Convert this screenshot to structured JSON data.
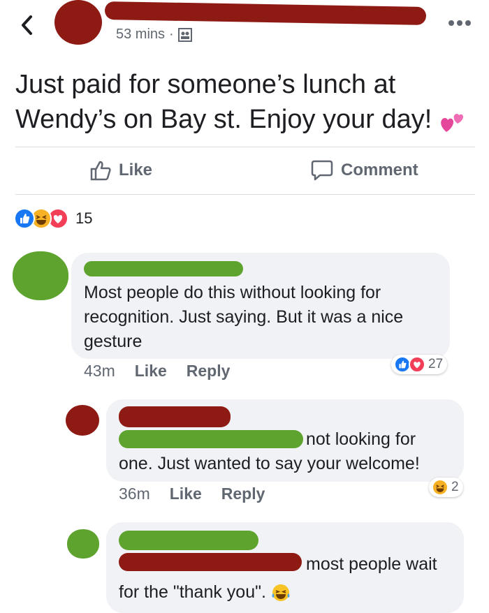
{
  "header": {
    "timestamp": "53 mins",
    "separator": "·"
  },
  "post": {
    "text_line1": "Just paid for someone’s lunch at",
    "text_line2": "Wendy’s on Bay st. Enjoy your day!"
  },
  "actions": {
    "like": "Like",
    "comment": "Comment"
  },
  "reactions": {
    "count": "15"
  },
  "comments": [
    {
      "text": "Most people do this without looking for recognition. Just saying. But it was a nice gesture",
      "line1": "Most people do this without looking for",
      "line2": "recognition. Just saying. But it was a nice",
      "line3": "gesture",
      "time": "43m",
      "like": "Like",
      "reply": "Reply",
      "reaction_count": "27"
    },
    {
      "line1": "not looking for",
      "line2": "one. Just wanted to say your welcome!",
      "time": "36m",
      "like": "Like",
      "reply": "Reply",
      "reaction_count": "2"
    },
    {
      "line1": "most people wait",
      "line2": "for the \"thank you\"."
    }
  ],
  "colors": {
    "redaction_red": "#8e1a14",
    "redaction_green": "#5ea32e",
    "like_blue": "#1877f2",
    "love_red": "#f33e58",
    "haha_yellow": "#f7b125"
  }
}
